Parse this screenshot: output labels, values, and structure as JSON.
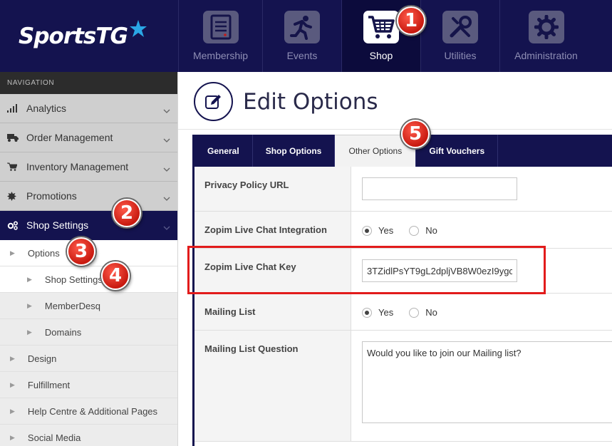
{
  "logo": {
    "text": "SportsTG"
  },
  "topnav": [
    {
      "label": "Membership",
      "icon": "membership-card-icon"
    },
    {
      "label": "Events",
      "icon": "runner-icon"
    },
    {
      "label": "Shop",
      "icon": "shopping-cart-icon",
      "active": true
    },
    {
      "label": "Utilities",
      "icon": "wrench-screwdriver-icon"
    },
    {
      "label": "Administration",
      "icon": "gear-icon"
    }
  ],
  "sidebar": {
    "header": "NAVIGATION",
    "items": [
      {
        "label": "Analytics",
        "icon": "signal-bars-icon"
      },
      {
        "label": "Order Management",
        "icon": "truck-icon"
      },
      {
        "label": "Inventory Management",
        "icon": "cart-icon"
      },
      {
        "label": "Promotions",
        "icon": "starburst-icon"
      },
      {
        "label": "Shop Settings",
        "icon": "cogs-icon",
        "active": true
      }
    ],
    "sub": {
      "options": "Options",
      "shop_settings": "Shop Settings",
      "memberdesq": "MemberDesq",
      "domains": "Domains",
      "design": "Design",
      "fulfillment": "Fulfillment",
      "help": "Help Centre & Additional Pages",
      "social": "Social Media"
    }
  },
  "page": {
    "title": "Edit Options"
  },
  "tabs": [
    {
      "label": "General"
    },
    {
      "label": "Shop Options"
    },
    {
      "label": "Other Options",
      "active": true
    },
    {
      "label": "Gift Vouchers"
    }
  ],
  "form": {
    "privacy_label": "Privacy Policy URL",
    "privacy_value": "",
    "zopim_integration_label": "Zopim Live Chat Integration",
    "yes": "Yes",
    "no": "No",
    "zopim_key_label": "Zopim Live Chat Key",
    "zopim_key_value": "3TZidlPsYT9gL2dpljVB8W0ezI9ygc",
    "mailing_list_label": "Mailing List",
    "mailing_question_label": "Mailing List Question",
    "mailing_question_value": "Would you like to join our Mailing list?"
  },
  "annotations": {
    "b1": "1",
    "b2": "2",
    "b3": "3",
    "b4": "4",
    "b5": "5"
  },
  "colors": {
    "navy": "#14134f",
    "annotation_red": "#e21b1b"
  }
}
